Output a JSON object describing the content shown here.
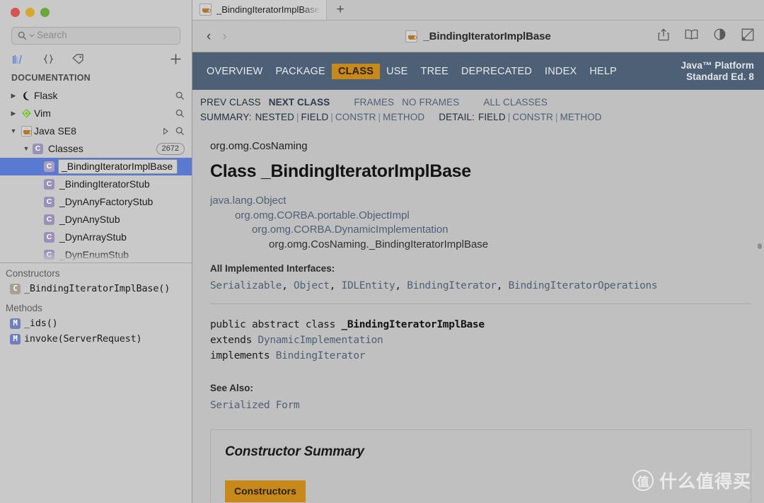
{
  "window": {
    "traffic_lights": [
      "close",
      "minimize",
      "zoom"
    ]
  },
  "sidebar": {
    "search": {
      "placeholder": "Search",
      "value": ""
    },
    "toolbar_icons": [
      "docset-icon",
      "braces-icon",
      "tag-icon",
      "plus-icon"
    ],
    "section_label": "DOCUMENTATION",
    "tree": [
      {
        "label": "Flask",
        "icon": "flask-docset-icon",
        "twisty": "collapsed",
        "depth": 0,
        "right": "search-icon"
      },
      {
        "label": "Vim",
        "icon": "vim-docset-icon",
        "twisty": "collapsed",
        "depth": 0,
        "right": "search-icon"
      },
      {
        "label": "Java SE8",
        "icon": "java-docset-icon",
        "twisty": "expanded",
        "depth": 0,
        "right": "play-search-icon"
      },
      {
        "label": "Classes",
        "icon": "class-badge",
        "twisty": "expanded",
        "depth": 1,
        "count": "2672"
      },
      {
        "label": "_BindingIteratorImplBase",
        "icon": "class-badge",
        "depth": 2,
        "selected": true,
        "editing": true
      },
      {
        "label": "_BindingIteratorStub",
        "icon": "class-badge",
        "depth": 2
      },
      {
        "label": "_DynAnyFactoryStub",
        "icon": "class-badge",
        "depth": 2
      },
      {
        "label": "_DynAnyStub",
        "icon": "class-badge",
        "depth": 2
      },
      {
        "label": "_DynArrayStub",
        "icon": "class-badge",
        "depth": 2
      },
      {
        "label": "_DynEnumStub",
        "icon": "class-badge",
        "depth": 2
      }
    ],
    "details": {
      "constructors_label": "Constructors",
      "constructors": [
        {
          "label": "_BindingIteratorImplBase()",
          "icon": "constructor-badge"
        }
      ],
      "methods_label": "Methods",
      "methods": [
        {
          "label": "_ids()",
          "icon": "method-badge"
        },
        {
          "label": "invoke(ServerRequest)",
          "icon": "method-badge"
        }
      ]
    }
  },
  "tabbar": {
    "tabs": [
      {
        "title": "_BindingIteratorImplBase",
        "icon": "java-icon",
        "active": true
      }
    ],
    "new_tab_label": "+"
  },
  "toolbar": {
    "back_label": "‹",
    "forward_label": "›",
    "doc_title": "_BindingIteratorImplBase",
    "doc_title_icon": "java-icon",
    "actions": [
      "share-icon",
      "book-icon",
      "contrast-icon",
      "annotate-icon"
    ]
  },
  "javadoc": {
    "topnav": {
      "items": [
        {
          "label": "OVERVIEW",
          "active": false
        },
        {
          "label": "PACKAGE",
          "active": false
        },
        {
          "label": "CLASS",
          "active": true
        },
        {
          "label": "USE",
          "active": false
        },
        {
          "label": "TREE",
          "active": false
        },
        {
          "label": "DEPRECATED",
          "active": false
        },
        {
          "label": "INDEX",
          "active": false
        },
        {
          "label": "HELP",
          "active": false
        }
      ],
      "brand_line1": "Java™ Platform",
      "brand_line2": "Standard Ed. 8",
      "bg_color": "#4e6076",
      "active_color": "#c8891b"
    },
    "subnav": {
      "prev_class": "PREV CLASS",
      "next_class": "NEXT CLASS",
      "frames": "FRAMES",
      "no_frames": "NO FRAMES",
      "all_classes": "ALL CLASSES",
      "summary_label": "SUMMARY:",
      "summary_items": [
        "NESTED",
        "FIELD",
        "CONSTR",
        "METHOD"
      ],
      "detail_label": "DETAIL:",
      "detail_items": [
        "FIELD",
        "CONSTR",
        "METHOD"
      ]
    },
    "package_name": "org.omg.CosNaming",
    "class_title": "Class _BindingIteratorImplBase",
    "hierarchy": [
      "java.lang.Object",
      "org.omg.CORBA.portable.ObjectImpl",
      "org.omg.CORBA.DynamicImplementation",
      "org.omg.CosNaming._BindingIteratorImplBase"
    ],
    "interfaces_label": "All Implemented Interfaces:",
    "interfaces": [
      "Serializable",
      "Object",
      "IDLEntity",
      "BindingIterator",
      "BindingIteratorOperations"
    ],
    "signature": {
      "line1_prefix": "public abstract class ",
      "line1_name": "_BindingIteratorImplBase",
      "line2_prefix": "extends ",
      "line2_link": "DynamicImplementation",
      "line3_prefix": "implements ",
      "line3_link": "BindingIterator"
    },
    "see_also_label": "See Also:",
    "see_also_link": "Serialized Form",
    "constructor_summary_title": "Constructor Summary",
    "constructor_tab_label": "Constructors"
  },
  "watermark": {
    "mark": "值",
    "text": "什么值得买"
  }
}
